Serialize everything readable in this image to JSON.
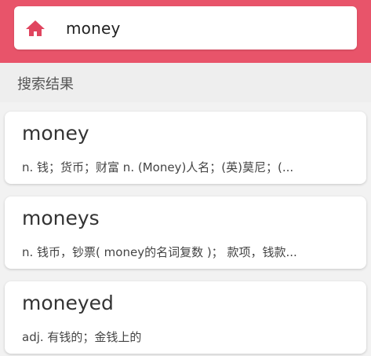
{
  "search": {
    "query": "money"
  },
  "section": {
    "title": "搜索结果"
  },
  "results": [
    {
      "word": "money",
      "definition": "n. 钱；货币；财富 n. (Money)人名；(英)莫尼；(..."
    },
    {
      "word": "moneys",
      "definition": "n. 钱币，钞票( money的名词复数 )； 款项，钱款..."
    },
    {
      "word": "moneyed",
      "definition": "adj. 有钱的；金钱上的"
    }
  ],
  "colors": {
    "topbar": "#e8546a",
    "home_icon": "#e0455f"
  },
  "icons": {
    "home": "home-icon"
  }
}
